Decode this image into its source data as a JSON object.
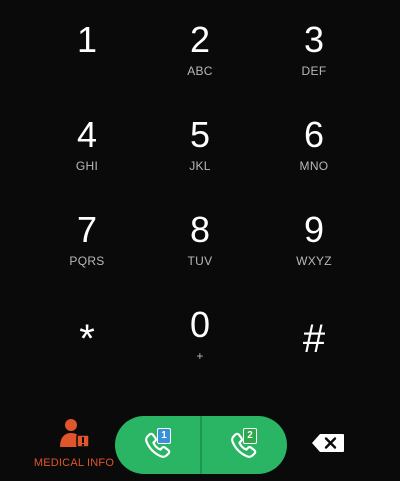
{
  "keypad": {
    "keys": [
      {
        "digit": "1",
        "letters": ""
      },
      {
        "digit": "2",
        "letters": "ABC"
      },
      {
        "digit": "3",
        "letters": "DEF"
      },
      {
        "digit": "4",
        "letters": "GHI"
      },
      {
        "digit": "5",
        "letters": "JKL"
      },
      {
        "digit": "6",
        "letters": "MNO"
      },
      {
        "digit": "7",
        "letters": "PQRS"
      },
      {
        "digit": "8",
        "letters": "TUV"
      },
      {
        "digit": "9",
        "letters": "WXYZ"
      },
      {
        "digit": "*",
        "letters": ""
      },
      {
        "digit": "0",
        "letters": "+"
      },
      {
        "digit": "#",
        "letters": ""
      }
    ]
  },
  "bottom_bar": {
    "medical_info_label": "MEDICAL INFO",
    "medical_icon": "person-medical-icon",
    "call_sim1": {
      "icon": "phone-icon",
      "sim_label": "1",
      "sim_color": "#3a8fd9"
    },
    "call_sim2": {
      "icon": "phone-icon",
      "sim_label": "2",
      "sim_color": "#2ea84a"
    },
    "backspace_icon": "backspace-icon"
  },
  "colors": {
    "background": "#0a0a0a",
    "call_button": "#2ab565",
    "medical_accent": "#e0562a",
    "letters": "#b8b8b8"
  }
}
